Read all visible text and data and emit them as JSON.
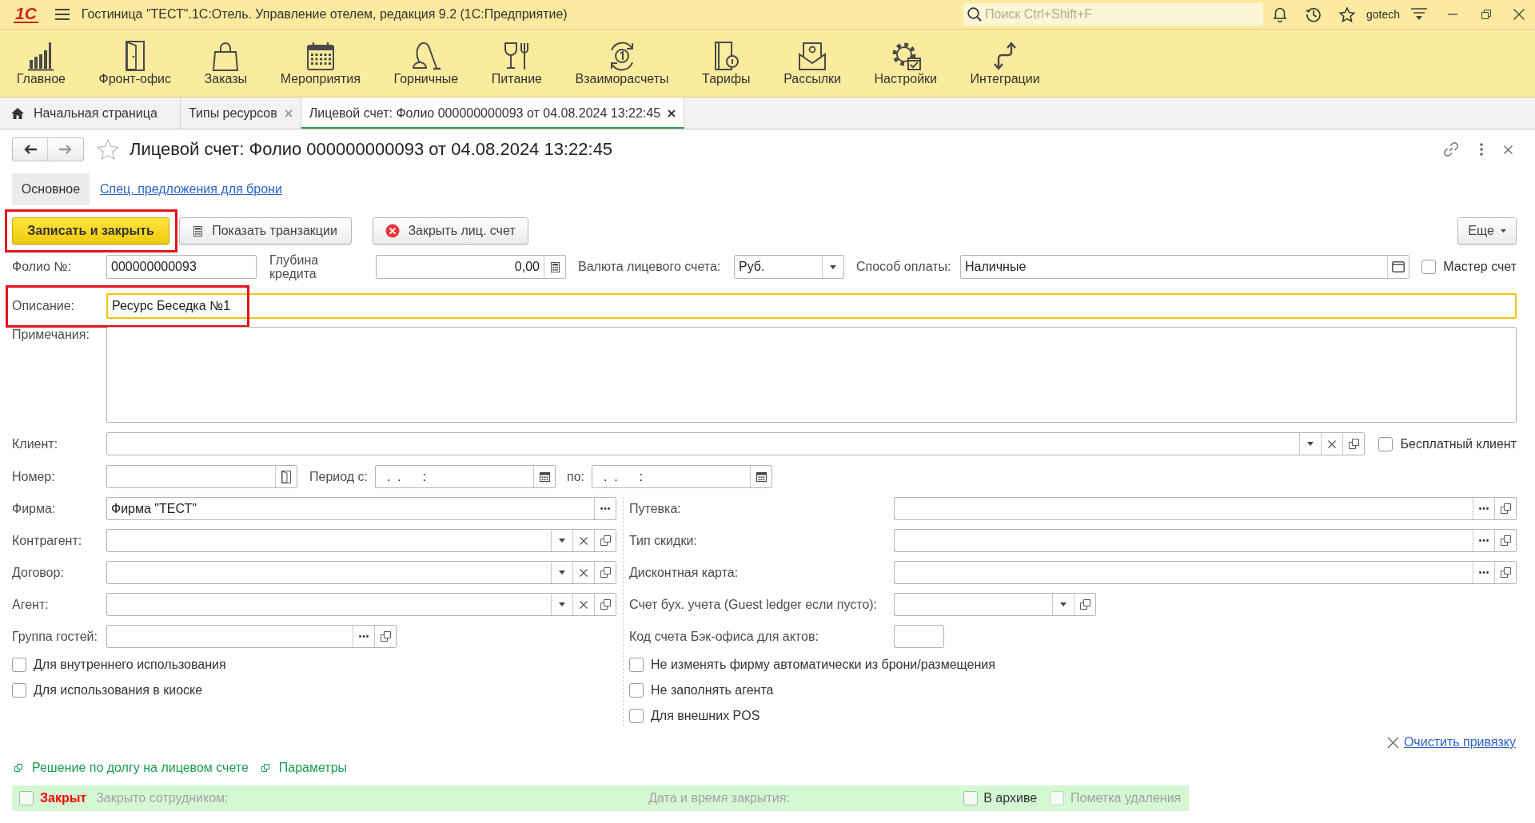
{
  "title_bar": {
    "logo": "1С",
    "app_title": "Гостиница \"ТЕСТ\".1С:Отель. Управление отелем, редакция 9.2 (1С:Предприятие)",
    "search": {
      "placeholder": "Поиск Ctrl+Shift+F"
    },
    "user": "gotech"
  },
  "sections": [
    {
      "label": "Главное"
    },
    {
      "label": "Фронт-офис"
    },
    {
      "label": "Заказы"
    },
    {
      "label": "Мероприятия"
    },
    {
      "label": "Горничные"
    },
    {
      "label": "Питание"
    },
    {
      "label": "Взаиморасчеты"
    },
    {
      "label": "Тарифы"
    },
    {
      "label": "Рассылки"
    },
    {
      "label": "Настройки"
    },
    {
      "label": "Интеграции"
    }
  ],
  "page_tabs": [
    {
      "label": "Начальная страница",
      "kind": "home",
      "selected": false
    },
    {
      "label": "Типы ресурсов",
      "kind": "document",
      "selected": false
    },
    {
      "label": "Лицевой счет: Фолио 000000000093 от 04.08.2024 13:22:45",
      "kind": "document",
      "selected": true
    }
  ],
  "form": {
    "title": "Лицевой счет: Фолио 000000000093 от 04.08.2024 13:22:45",
    "favorite": false,
    "tabs": [
      {
        "label": "Основное",
        "selected": true
      },
      {
        "label": "Спец. предложения для брони",
        "selected": false
      }
    ],
    "commands": [
      {
        "label": "Записать и закрыть",
        "kind": "primary",
        "highlighted": true
      },
      {
        "label": "Показать транзакции",
        "kind": "report",
        "highlighted": false
      },
      {
        "label": "Закрыть лиц. счет",
        "kind": "cancel",
        "highlighted": false
      }
    ],
    "more_button": "Еще",
    "folio": {
      "label": "Фолио №:",
      "value": "000000000093"
    },
    "credit_depth": {
      "label": "Глубина кредита",
      "value": "0,00",
      "buttons": [
        {
          "kind": "calculator"
        }
      ]
    },
    "currency": {
      "label": "Валюта лицевого счета:",
      "value": "Руб.",
      "buttons": [
        {
          "kind": "dropdown"
        }
      ]
    },
    "payment_method": {
      "label": "Способ оплаты:",
      "value": "Наличные",
      "buttons": [
        {
          "kind": "choose"
        }
      ]
    },
    "master_account": {
      "label": "Мастер счет",
      "checked": false
    },
    "description": {
      "label": "Описание:",
      "value": "Ресурс Беседка №1",
      "focused": true,
      "highlighted": true
    },
    "notes": {
      "label": "Примечания:"
    },
    "client": {
      "label": "Клиент:",
      "buttons": [
        {
          "kind": "dropdown"
        },
        {
          "kind": "clear"
        },
        {
          "kind": "open"
        }
      ]
    },
    "free_client": {
      "label": "Бесплатный клиент",
      "checked": false
    },
    "room": {
      "label": "Номер:",
      "buttons": [
        {
          "kind": "rooms"
        }
      ]
    },
    "period_from": {
      "label": "Период с:",
      "value": ".  .      :",
      "buttons": [
        {
          "kind": "calendar"
        }
      ]
    },
    "period_to": {
      "label": "по:",
      "value": ".  .      :",
      "buttons": [
        {
          "kind": "calendar"
        }
      ]
    },
    "left_fields": [
      {
        "label": "Фирма:",
        "value": "Фирма \"ТЕСТ\"",
        "buttons": [
          {
            "kind": "select"
          }
        ]
      },
      {
        "label": "Контрагент:",
        "buttons": [
          {
            "kind": "dropdown"
          },
          {
            "kind": "clear"
          },
          {
            "kind": "open"
          }
        ]
      },
      {
        "label": "Договор:",
        "buttons": [
          {
            "kind": "dropdown"
          },
          {
            "kind": "clear"
          },
          {
            "kind": "open"
          }
        ]
      },
      {
        "label": "Агент:",
        "buttons": [
          {
            "kind": "dropdown"
          },
          {
            "kind": "clear"
          },
          {
            "kind": "open"
          }
        ]
      }
    ],
    "guest_group": {
      "label": "Группа гостей:",
      "buttons": [
        {
          "kind": "select"
        },
        {
          "kind": "open"
        }
      ]
    },
    "left_checkboxes": [
      {
        "label": "Для внутреннего использования",
        "checked": false
      },
      {
        "label": "Для использования в киоске",
        "checked": false
      }
    ],
    "right_fields": [
      {
        "label": "Путевка:",
        "buttons": [
          {
            "kind": "select"
          },
          {
            "kind": "open"
          }
        ]
      },
      {
        "label": "Тип скидки:",
        "buttons": [
          {
            "kind": "select"
          },
          {
            "kind": "open"
          }
        ]
      },
      {
        "label": "Дисконтная карта:",
        "buttons": [
          {
            "kind": "select"
          },
          {
            "kind": "open"
          }
        ]
      }
    ],
    "ledger_account": {
      "label": "Счет бух. учета (Guest ledger если пусто):",
      "buttons": [
        {
          "kind": "dropdown"
        },
        {
          "kind": "open"
        }
      ]
    },
    "backoffice_code": {
      "label": "Код счета Бэк-офиса для актов:"
    },
    "right_checkboxes": [
      {
        "label": "Не изменять фирму автоматически из брони/размещения",
        "checked": false
      },
      {
        "label": "Не заполнять агента",
        "checked": false
      },
      {
        "label": "Для внешних POS",
        "checked": false
      }
    ],
    "clear_link": "Очистить привязку",
    "links": [
      {
        "label": "Решение по долгу на лицевом счете"
      },
      {
        "label": "Параметры"
      }
    ]
  },
  "status_bar": {
    "closed": {
      "label": "Закрыт",
      "checked": false
    },
    "closed_by": "Закрыто сотрудником:",
    "closed_at": "Дата и время закрытия:",
    "archived": {
      "label": "В архиве",
      "checked": false
    },
    "deletion_mark": {
      "label": "Пометка удаления",
      "checked": false,
      "disabled": true
    }
  }
}
